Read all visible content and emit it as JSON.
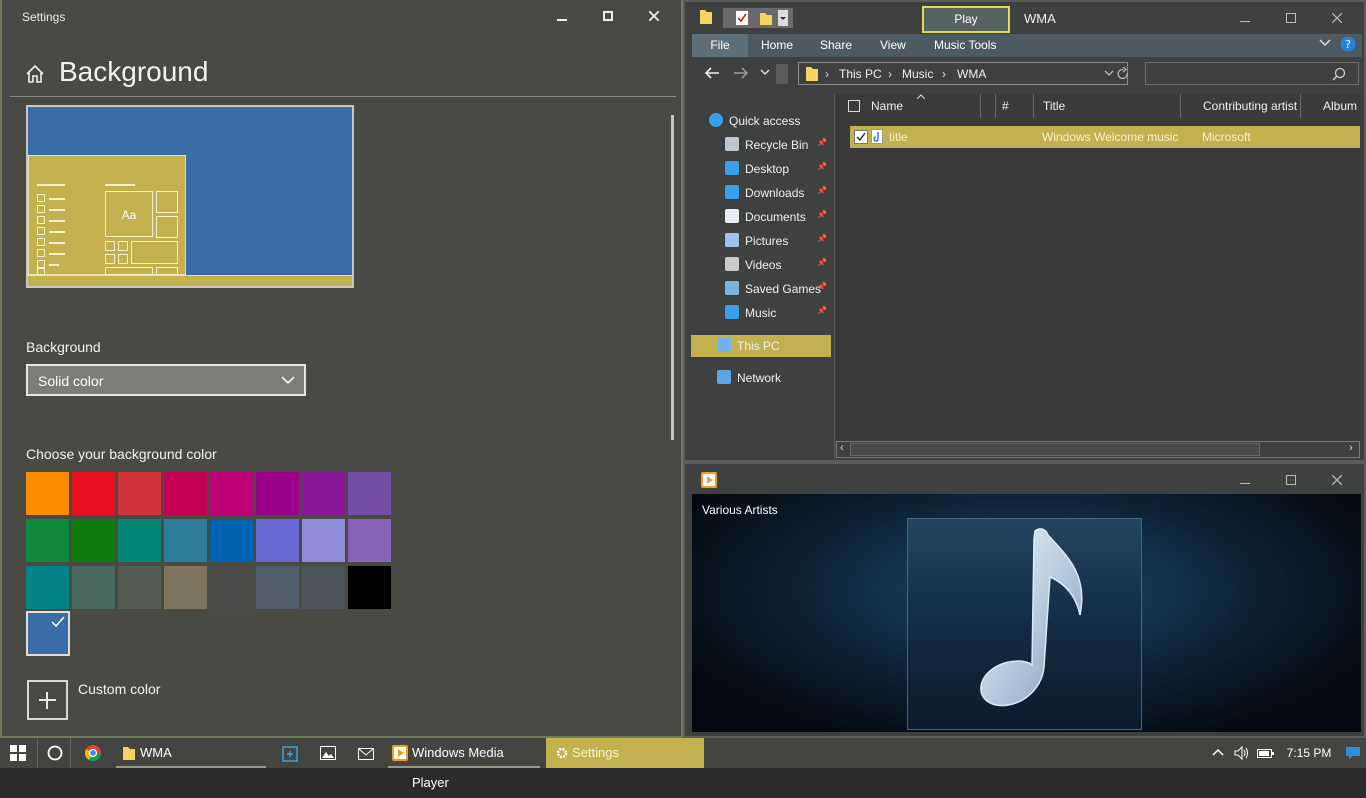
{
  "settings": {
    "window_title": "Settings",
    "page_title": "Background",
    "preview_tile_text": "Aa",
    "background_label": "Background",
    "background_value": "Solid color",
    "choose_color_label": "Choose your background color",
    "custom_color_label": "Custom color",
    "colors": [
      "#ff8c00",
      "#e81123",
      "#d13438",
      "#c30052",
      "#bf0077",
      "#9a0089",
      "#881798",
      "#744da9",
      "#10893e",
      "#107c10",
      "#018574",
      "#2d7d9a",
      "#0063b1",
      "#6b69d6",
      "#8e8cd8",
      "#8764b8",
      "#038387",
      "#486860",
      "#525e54",
      "#7e735f",
      "#4c4a48",
      "#515c6b",
      "#4a5459",
      "#000000",
      "#3a6ca8"
    ],
    "selected_color": "#3a6ca8"
  },
  "explorer": {
    "window_title": "WMA",
    "context_tab": "Play",
    "ribbon_tabs": [
      "File",
      "Home",
      "Share",
      "View",
      "Music Tools"
    ],
    "breadcrumb": [
      "This PC",
      "Music",
      "WMA"
    ],
    "nav_items": [
      {
        "label": "Quick access",
        "icon": "star-icon",
        "pinned": false
      },
      {
        "label": "Recycle Bin",
        "icon": "recycle-bin-icon",
        "pinned": true
      },
      {
        "label": "Desktop",
        "icon": "desktop-icon",
        "pinned": true
      },
      {
        "label": "Downloads",
        "icon": "download-icon",
        "pinned": true
      },
      {
        "label": "Documents",
        "icon": "document-icon",
        "pinned": true
      },
      {
        "label": "Pictures",
        "icon": "pictures-icon",
        "pinned": true
      },
      {
        "label": "Videos",
        "icon": "video-icon",
        "pinned": true
      },
      {
        "label": "Saved Games",
        "icon": "games-icon",
        "pinned": true
      },
      {
        "label": "Music",
        "icon": "music-icon",
        "pinned": true
      },
      {
        "label": "This PC",
        "icon": "computer-icon",
        "pinned": false
      },
      {
        "label": "Network",
        "icon": "network-icon",
        "pinned": false
      }
    ],
    "columns": [
      "Name",
      "#",
      "Title",
      "Contributing artist",
      "Album"
    ],
    "file": {
      "name": "title",
      "number": "",
      "title": "Windows Welcome music",
      "artist": "Microsoft"
    }
  },
  "media_player": {
    "artist": "Various Artists"
  },
  "taskbar": {
    "items": [
      {
        "label": "WMA"
      },
      {
        "label": "Windows Media Player"
      },
      {
        "label": "Settings"
      }
    ],
    "clock": "7:15 PM"
  },
  "colors": {
    "accent": "#c3b14f",
    "window_bg": "#494a44",
    "play_tab_border": "#e1d85c"
  }
}
